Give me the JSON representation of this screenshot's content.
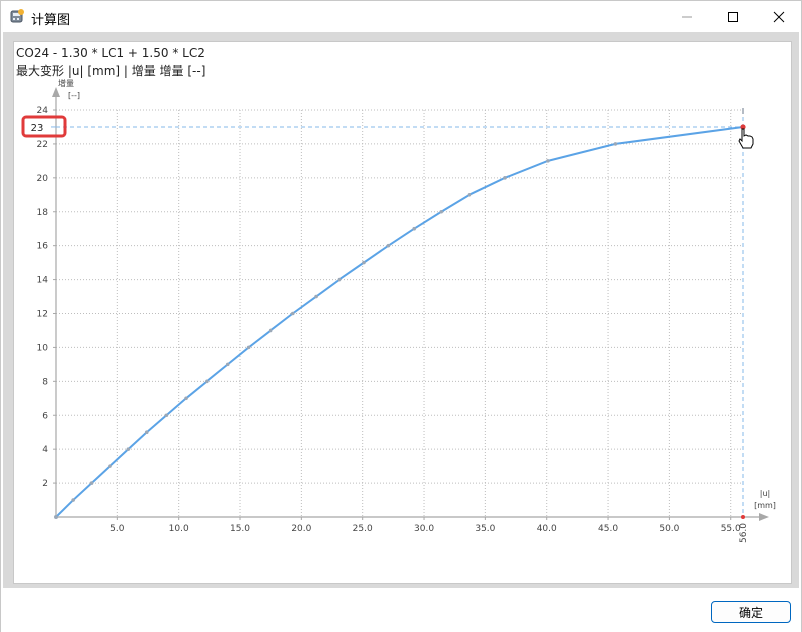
{
  "window": {
    "title": "计算图",
    "icon": "calculator-chart-icon",
    "controls": {
      "minimize": "minimize-icon",
      "maximize": "maximize-icon",
      "close": "close-icon"
    }
  },
  "chart_header": {
    "line1": "CO24 - 1.30 * LC1 + 1.50 * LC2",
    "line2": "最大变形 |u| [mm] | 增量 增量 [--]"
  },
  "chart_data": {
    "type": "line",
    "ylabel": "增量",
    "yunit": "[--]",
    "xlabel": "|u|",
    "xunit": "[mm]",
    "xlim": [
      0,
      56.0
    ],
    "ylim": [
      0,
      24
    ],
    "xticks": [
      "5.0",
      "10.0",
      "15.0",
      "20.0",
      "25.0",
      "30.0",
      "35.0",
      "40.0",
      "45.0",
      "50.0",
      "55.0"
    ],
    "xtick_values": [
      5,
      10,
      15,
      20,
      25,
      30,
      35,
      40,
      45,
      50,
      55
    ],
    "yticks": [
      "2",
      "4",
      "6",
      "8",
      "10",
      "12",
      "14",
      "16",
      "18",
      "20",
      "22",
      "24"
    ],
    "ytick_values": [
      2,
      4,
      6,
      8,
      10,
      12,
      14,
      16,
      18,
      20,
      22,
      24
    ],
    "x_end_label": "56.0",
    "highlight_y_label": "23",
    "grid": true,
    "series": [
      {
        "color": "#5ba3e6",
        "x": [
          0,
          1.4,
          2.9,
          4.4,
          5.9,
          7.4,
          9.0,
          10.6,
          12.3,
          14.0,
          15.7,
          17.5,
          19.3,
          21.2,
          23.1,
          25.1,
          27.1,
          29.2,
          31.4,
          33.7,
          36.6,
          40.1,
          45.6,
          56.0
        ],
        "y": [
          0,
          1,
          2,
          3,
          4,
          5,
          6,
          7,
          8,
          9,
          10,
          11,
          12,
          13,
          14,
          15,
          16,
          17,
          18,
          19,
          20,
          21,
          22,
          23
        ]
      }
    ],
    "highlight_point": {
      "x": 56.0,
      "y": 23
    },
    "highlight_color": "#e03a3a"
  },
  "footer": {
    "ok_label": "确定"
  },
  "cursor": "hand-pointer-icon"
}
